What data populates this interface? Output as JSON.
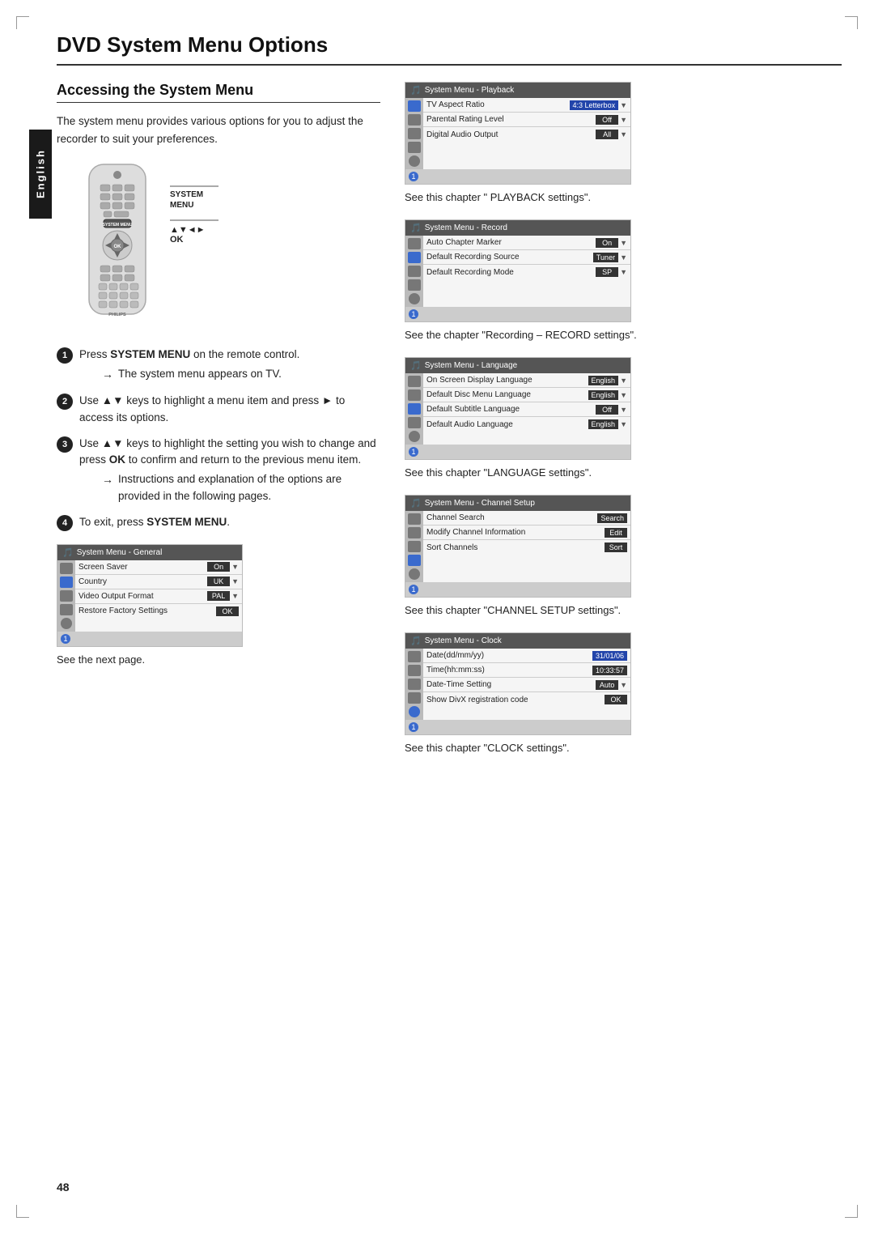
{
  "page": {
    "title": "DVD System Menu Options",
    "number": "48",
    "english_tab": "English"
  },
  "left": {
    "section_title": "Accessing the System Menu",
    "intro": "The system menu provides various options for you to adjust the recorder to suit your preferences.",
    "remote_labels": {
      "arrows": "▲▼◄►",
      "ok": "OK",
      "system_menu_line1": "System",
      "system_menu_line2": "Menu"
    },
    "steps": [
      {
        "number": "1",
        "text": "Press ",
        "bold": "SYSTEM MENU",
        "text2": " on the remote control.",
        "note": "The system menu appears on TV."
      },
      {
        "number": "2",
        "text": "Use ▲▼ keys to highlight a menu item and press ► to access its options."
      },
      {
        "number": "3",
        "text": "Use ▲▼ keys to highlight the setting you wish to change and press ",
        "bold": "OK",
        "text2": " to confirm and return to the previous menu item.",
        "note": "Instructions and explanation of the options are provided in the following pages."
      },
      {
        "number": "4",
        "text": "To exit, press ",
        "bold": "SYSTEM MENU",
        "text2": "."
      }
    ],
    "general_menu": {
      "title": "System Menu - General",
      "rows": [
        {
          "label": "Screen Saver",
          "value": "On",
          "has_dropdown": true
        },
        {
          "label": "Country",
          "value": "UK",
          "has_dropdown": true
        },
        {
          "label": "Video Output Format",
          "value": "PAL",
          "has_dropdown": true
        },
        {
          "label": "Restore Factory Settings",
          "value": "OK",
          "has_dropdown": false
        }
      ],
      "caption": "See the next page."
    }
  },
  "right": {
    "menus": [
      {
        "id": "playback",
        "title": "System Menu - Playback",
        "rows": [
          {
            "label": "TV Aspect Ratio",
            "value": "4:3 Letterbox",
            "has_dropdown": true
          },
          {
            "label": "Parental Rating Level",
            "value": "Off",
            "has_dropdown": true
          },
          {
            "label": "Digital Audio Output",
            "value": "All",
            "has_dropdown": true
          }
        ],
        "caption": "See this chapter \" PLAYBACK settings\"."
      },
      {
        "id": "record",
        "title": "System Menu - Record",
        "rows": [
          {
            "label": "Auto Chapter Marker",
            "value": "On",
            "has_dropdown": true
          },
          {
            "label": "Default Recording Source",
            "value": "Tuner",
            "has_dropdown": true
          },
          {
            "label": "Default Recording Mode",
            "value": "SP",
            "has_dropdown": true
          }
        ],
        "caption": "See the chapter \"Recording – RECORD settings\"."
      },
      {
        "id": "language",
        "title": "System Menu - Language",
        "rows": [
          {
            "label": "On Screen Display Language",
            "value": "English",
            "has_dropdown": true
          },
          {
            "label": "Default Disc Menu Language",
            "value": "English",
            "has_dropdown": true
          },
          {
            "label": "Default Subtitle Language",
            "value": "Off",
            "has_dropdown": true
          },
          {
            "label": "Default Audio Language",
            "value": "English",
            "has_dropdown": true
          }
        ],
        "caption": "See this chapter \"LANGUAGE settings\"."
      },
      {
        "id": "channel",
        "title": "System Menu - Channel Setup",
        "rows": [
          {
            "label": "Channel Search",
            "value": "Search",
            "has_dropdown": false
          },
          {
            "label": "Modify Channel Information",
            "value": "Edit",
            "has_dropdown": false
          },
          {
            "label": "Sort Channels",
            "value": "Sort",
            "has_dropdown": false
          }
        ],
        "caption": "See this chapter \"CHANNEL SETUP settings\"."
      },
      {
        "id": "clock",
        "title": "System Menu - Clock",
        "rows": [
          {
            "label": "Date(dd/mm/yy)",
            "value": "31/01/06",
            "has_dropdown": false
          },
          {
            "label": "Time(hh:mm:ss)",
            "value": "10:33:57",
            "has_dropdown": false
          },
          {
            "label": "Date-Time Setting",
            "value": "Auto",
            "has_dropdown": true
          },
          {
            "label": "Show DivX registration code",
            "value": "OK",
            "has_dropdown": false
          }
        ],
        "caption": "See this chapter \"CLOCK settings\"."
      }
    ]
  }
}
